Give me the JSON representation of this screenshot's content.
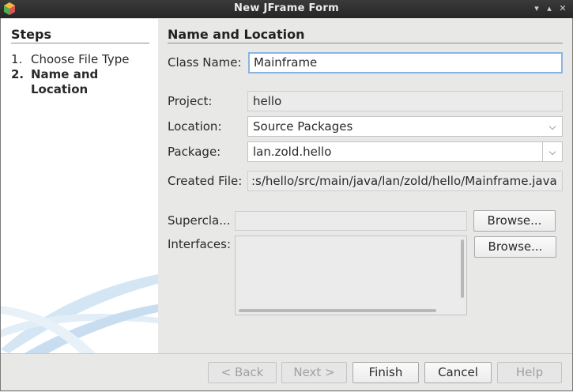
{
  "window": {
    "title": "New JFrame Form"
  },
  "steps": {
    "heading": "Steps",
    "items": [
      {
        "num": "1.",
        "label": "Choose File Type"
      },
      {
        "num": "2.",
        "label_line1": "Name and",
        "label_line2": "Location"
      }
    ]
  },
  "panel": {
    "title": "Name and Location",
    "class_name_label": "Class Name:",
    "class_name_value": "Mainframe",
    "project_label": "Project:",
    "project_value": "hello",
    "location_label": "Location:",
    "location_value": "Source Packages",
    "package_label": "Package:",
    "package_value": "lan.zold.hello",
    "created_file_label": "Created File:",
    "created_file_value": ":s/hello/src/main/java/lan/zold/hello/Mainframe.java",
    "superclass_label": "Supercla...",
    "superclass_value": "",
    "browse_label": "Browse...",
    "interfaces_label": "Interfaces:"
  },
  "buttons": {
    "back": "< Back",
    "next": "Next >",
    "finish": "Finish",
    "cancel": "Cancel",
    "help": "Help"
  }
}
